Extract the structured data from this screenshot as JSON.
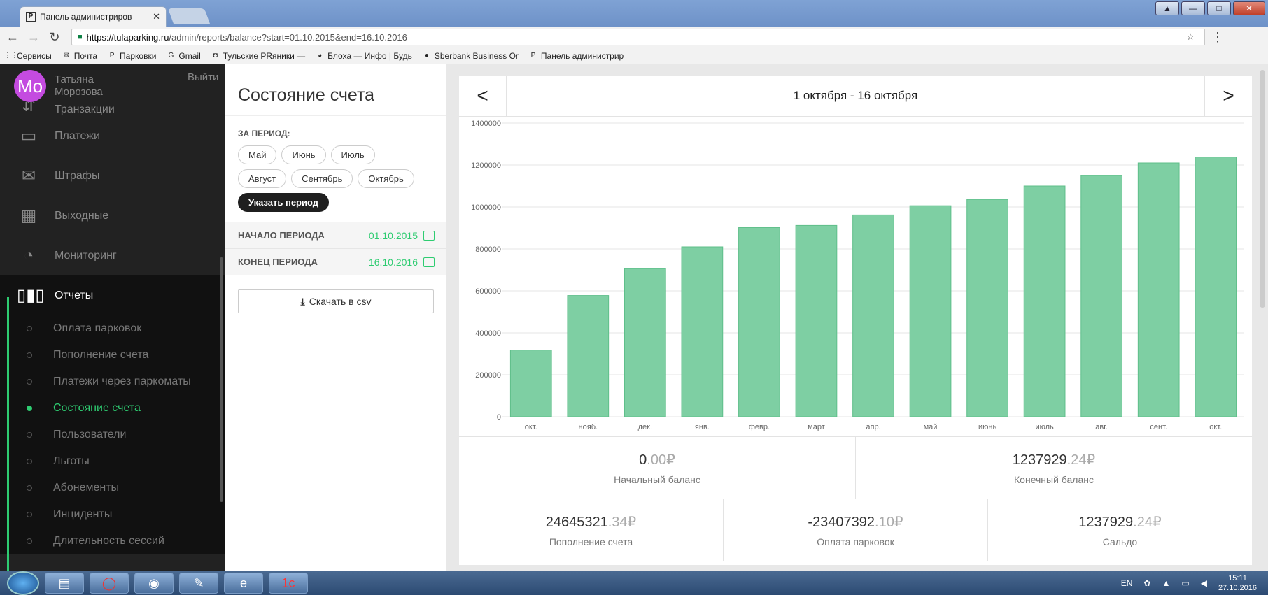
{
  "browser": {
    "tab_title": "Панель администриров",
    "tab_favicon": "P",
    "url_host": "https://tulaparking.ru",
    "url_path": "/admin/reports/balance?start=01.10.2015&end=16.10.2016",
    "bookmarks": [
      {
        "icon": "apps-icon",
        "label": "Сервисы"
      },
      {
        "icon": "mail-icon",
        "label": "Почта"
      },
      {
        "icon": "p-icon",
        "label": "Парковки"
      },
      {
        "icon": "google-icon",
        "label": "Gmail"
      },
      {
        "icon": "bookmark-icon",
        "label": "Тульские PRяники —"
      },
      {
        "icon": "flea-icon",
        "label": "Блоха — Инфо | Будь"
      },
      {
        "icon": "sberbank-icon",
        "label": "Sberbank Business Or"
      },
      {
        "icon": "p-icon",
        "label": "Панель администрир"
      }
    ]
  },
  "sidebar": {
    "avatar": "Mo",
    "user_first": "Татьяна",
    "user_last": "Морозова",
    "logout": "Выйти",
    "items": [
      {
        "label": "Транзакции",
        "icon": "transactions-icon"
      },
      {
        "label": "Платежи",
        "icon": "card-icon"
      },
      {
        "label": "Штрафы",
        "icon": "envelope-icon"
      },
      {
        "label": "Выходные",
        "icon": "calendar-icon"
      },
      {
        "label": "Мониторинг",
        "icon": "gauge-icon"
      }
    ],
    "reports": "Отчеты",
    "sub_items": [
      "Оплата парковок",
      "Пополнение счета",
      "Платежи через паркоматы",
      "Состояние счета",
      "Пользователи",
      "Льготы",
      "Абонементы",
      "Инциденты",
      "Длительность сессий"
    ],
    "active_sub": 3
  },
  "panel": {
    "title": "Состояние счета",
    "period_label": "ЗА ПЕРИОД:",
    "chips": [
      "Май",
      "Июнь",
      "Июль",
      "Август",
      "Сентябрь",
      "Октябрь"
    ],
    "custom_period": "Указать период",
    "start_label": "НАЧАЛО ПЕРИОДА",
    "start_value": "01.10.2015",
    "end_label": "КОНЕЦ ПЕРИОДА",
    "end_value": "16.10.2016",
    "download": "Скачать в csv"
  },
  "main": {
    "range": "1 октября - 16 октября",
    "prev": "<",
    "next": ">",
    "stats_top": [
      {
        "int": "0",
        "dec": ".00",
        "cur": "₽",
        "cap": "Начальный баланс"
      },
      {
        "int": "1237929",
        "dec": ".24",
        "cur": "₽",
        "cap": "Конечный баланс"
      }
    ],
    "stats_bottom": [
      {
        "int": "24645321",
        "dec": ".34",
        "cur": "₽",
        "cap": "Пополнение счета"
      },
      {
        "int": "-23407392",
        "dec": ".10",
        "cur": "₽",
        "cap": "Оплата парковок"
      },
      {
        "int": "1237929",
        "dec": ".24",
        "cur": "₽",
        "cap": "Сальдо"
      }
    ]
  },
  "chart_data": {
    "type": "bar",
    "categories": [
      "окт.",
      "нояб.",
      "дек.",
      "янв.",
      "февр.",
      "март",
      "апр.",
      "май",
      "июнь",
      "июль",
      "авг.",
      "сент.",
      "окт."
    ],
    "values": [
      318000,
      578000,
      706000,
      810000,
      902000,
      912000,
      962000,
      1006000,
      1036000,
      1100000,
      1150000,
      1210000,
      1238000
    ],
    "ylim": [
      0,
      1400000
    ],
    "yticks": [
      "0",
      "200000",
      "400000",
      "600000",
      "800000",
      "1000000",
      "1200000",
      "1400000"
    ],
    "grid": true,
    "bar_color": "#7ecfa3"
  },
  "taskbar": {
    "lang": "EN",
    "time": "15:11",
    "date": "27.10.2016"
  }
}
